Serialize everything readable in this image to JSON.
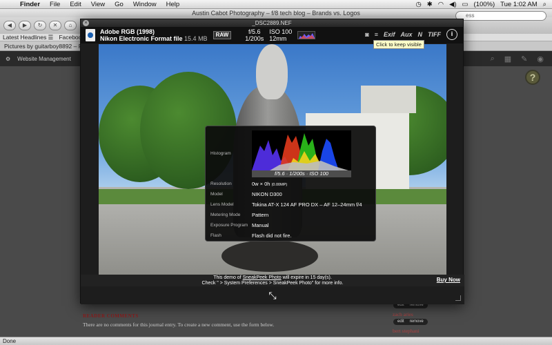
{
  "menubar": {
    "app": "Finder",
    "items": [
      "File",
      "Edit",
      "View",
      "Go",
      "Window",
      "Help"
    ],
    "battery": "(100%)",
    "clock": "Tue 1:02 AM"
  },
  "browser": {
    "title": "Austin Cabot Photography – f/8 tech blog – Brands vs. Logos",
    "url_fragment": "ess",
    "bookmarks": [
      "Latest Headlines ☰",
      "Facebook"
    ],
    "tab_label": "Pictures by guitarboy8892 – P",
    "site_menu": "Website Management",
    "status": "Done"
  },
  "page": {
    "comments_heading": "READER COMMENTS",
    "no_comments": "There are no comments for this journal entry. To create a new comment, use the form below.",
    "users": [
      "zach aries",
      "bert stephani"
    ],
    "pill_edit": "edit",
    "pill_remove": "remove"
  },
  "sneakpeek": {
    "filename": "_DSC2889.NEF",
    "color_profile": "Adobe RGB (1998)",
    "format": "Nikon Electronic Format file",
    "size": "15.4 MB",
    "raw_badge": "RAW",
    "aperture": "f/5.6",
    "shutter": "1/200s",
    "iso": "ISO 100",
    "focal": "12mm",
    "tools": [
      "Exif",
      "Aux",
      "N",
      "TIFF"
    ],
    "info": "i",
    "tooltip": "Click to keep visible",
    "exif": {
      "histogram_label": "Histogram",
      "histogram_caption": "f/5.6 · 1/200s · ISO 100",
      "rows": [
        {
          "label": "Resolution",
          "value": "0w × 0h",
          "extra": "(0.00MP)"
        },
        {
          "label": "Model",
          "value": "NIKON D300"
        },
        {
          "label": "Lens Model",
          "value": "Tokina AT-X 124 AF PRO DX – AF 12–24mm f/4"
        },
        {
          "label": "Metering Mode",
          "value": "Pattern"
        },
        {
          "label": "Exposure Program",
          "value": "Manual"
        },
        {
          "label": "Flash",
          "value": "Flash did not fire."
        }
      ]
    },
    "footer_line1_a": "This demo of ",
    "footer_link": "SneakPeek Photo",
    "footer_line1_b": " will expire in 15 day(s).",
    "footer_line2": "Check \" > System Preferences > SneakPeek Photo\" for more info.",
    "buy_now": "Buy Now"
  }
}
